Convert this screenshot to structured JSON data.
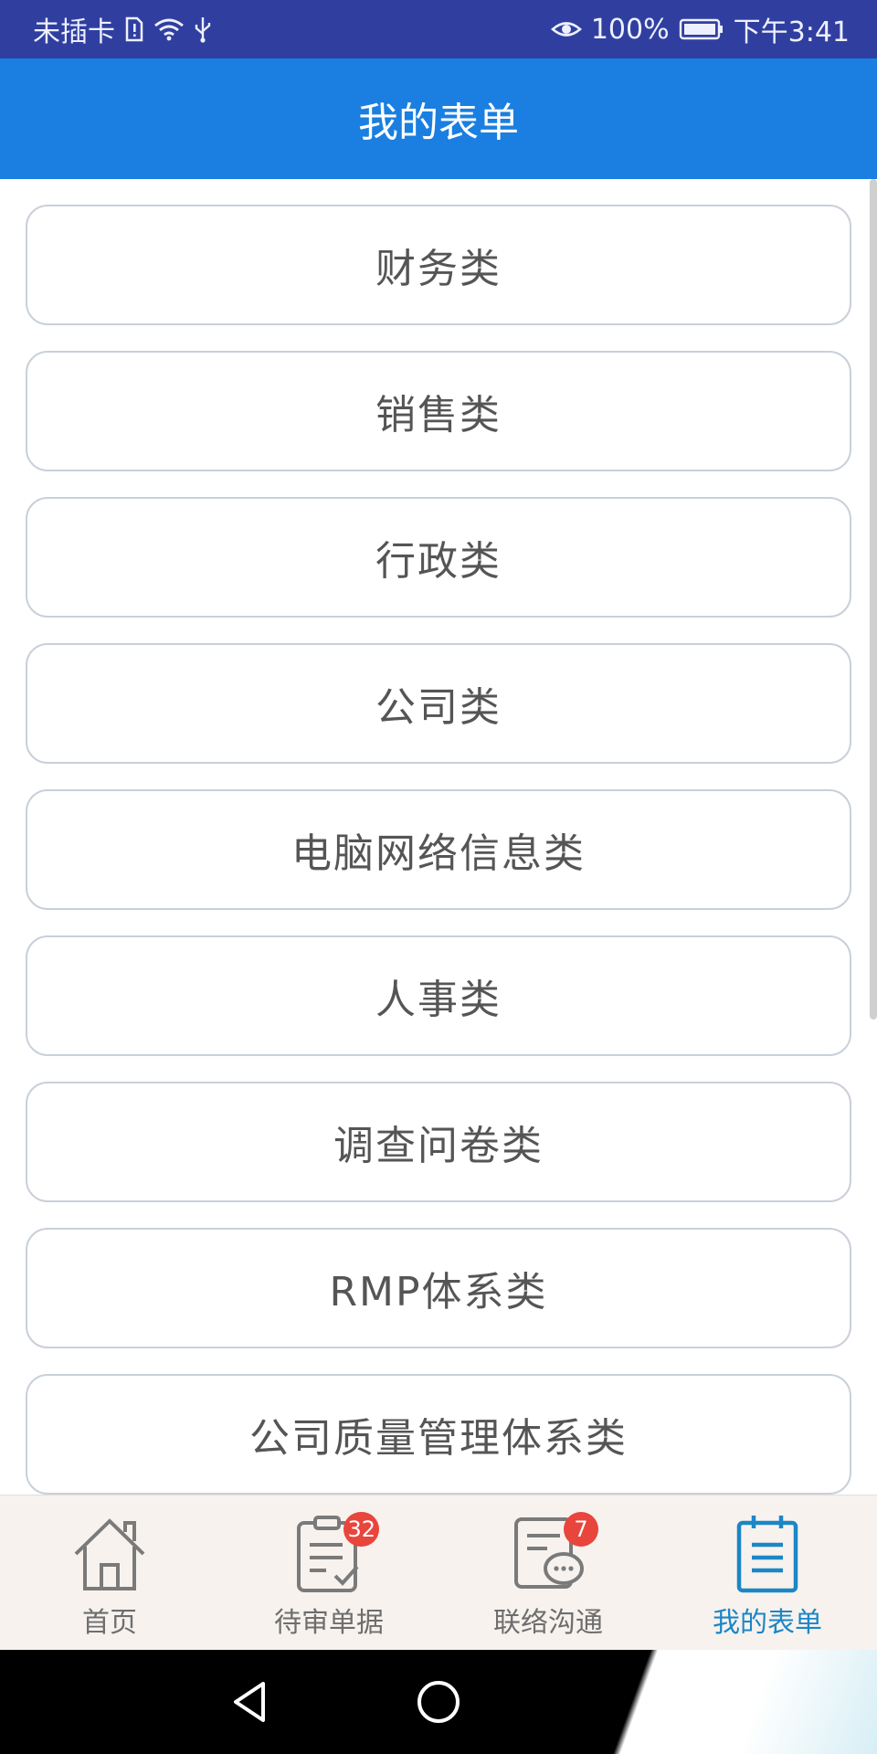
{
  "status_bar": {
    "carrier": "未插卡",
    "battery": "100%",
    "time": "下午3:41"
  },
  "header": {
    "title": "我的表单"
  },
  "categories": [
    {
      "label": "财务类"
    },
    {
      "label": "销售类"
    },
    {
      "label": "行政类"
    },
    {
      "label": "公司类"
    },
    {
      "label": "电脑网络信息类"
    },
    {
      "label": "人事类"
    },
    {
      "label": "调查问卷类"
    },
    {
      "label": "RMP体系类"
    },
    {
      "label": "公司质量管理体系类"
    }
  ],
  "tabs": [
    {
      "label": "首页",
      "icon": "home-icon"
    },
    {
      "label": "待审单据",
      "icon": "pending-documents-icon",
      "badge": "32"
    },
    {
      "label": "联络沟通",
      "icon": "chat-icon",
      "badge": "7"
    },
    {
      "label": "我的表单",
      "icon": "my-forms-icon",
      "active": true
    }
  ],
  "colors": {
    "status_bar": "#303f9f",
    "header": "#1a7fe0",
    "active_tab": "#1c86c6",
    "badge": "#e8453c",
    "item_border": "#c9d0da"
  }
}
